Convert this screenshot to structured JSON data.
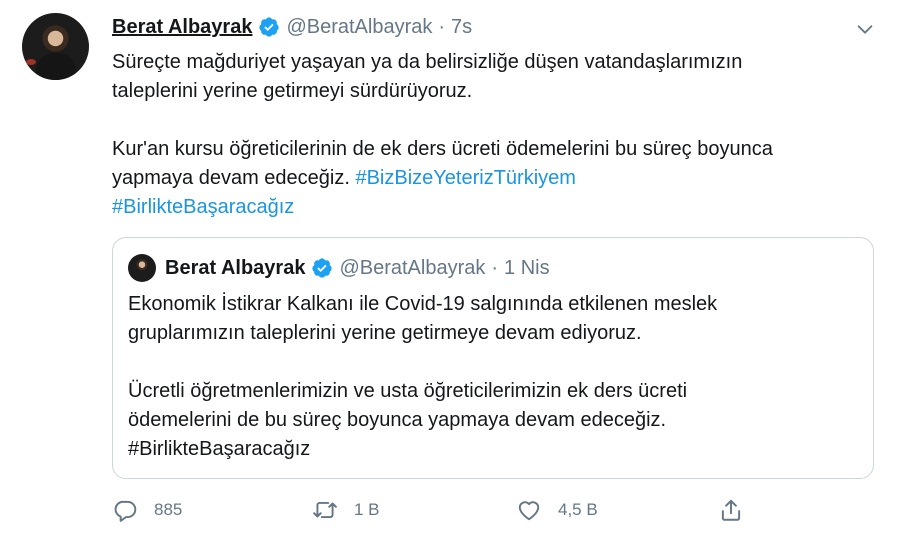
{
  "tweet": {
    "author_name": "Berat Albayrak",
    "handle": "@BeratAlbayrak",
    "separator": "·",
    "time": "7s",
    "paragraph1": "Süreçte mağduriyet yaşayan ya da belirsizliğe düşen vatandaşlarımızın\ntaleplerini yerine getirmeyi sürdürüyoruz.",
    "paragraph2": "Kur'an kursu öğreticilerinin de ek ders ücreti ödemelerini bu süreç boyunca\nyapmaya devam edeceğiz. ",
    "hashtag1": "#BizBizeYeterizTürkiyem",
    "hashtag2": "#BirlikteBaşaracağız"
  },
  "quoted_tweet": {
    "author_name": "Berat Albayrak",
    "handle": "@BeratAlbayrak",
    "separator": "·",
    "time": "1 Nis",
    "paragraph1": "Ekonomik İstikrar Kalkanı ile Covid-19 salgınında etkilenen meslek\ngruplarımızın taleplerini yerine getirmeye devam ediyoruz.",
    "paragraph2": "Ücretli öğretmenlerimizin ve usta öğreticilerimizin ek ders ücreti\nödemelerini de bu süreç boyunca yapmaya devam edeceğiz.\n#BirlikteBaşaracağız"
  },
  "actions": {
    "reply_count": "885",
    "retweet_count": "1 B",
    "like_count": "4,5 B"
  },
  "icons": {
    "verified": "verified-badge-icon",
    "more": "chevron-down-icon",
    "reply": "reply-icon",
    "retweet": "retweet-icon",
    "like": "heart-icon",
    "share": "share-icon"
  },
  "colors": {
    "text": "#14171a",
    "secondary": "#657786",
    "link": "#1b95e0",
    "verified": "#1da1f2",
    "border": "#ccd6dd"
  }
}
